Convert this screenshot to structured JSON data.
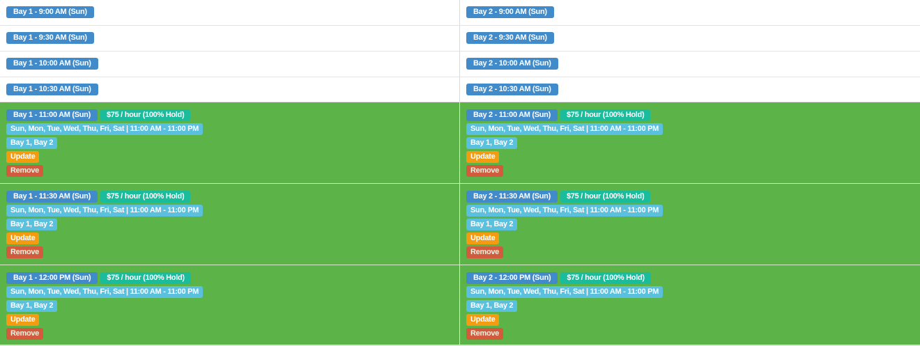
{
  "slots": [
    {
      "booked": false,
      "cells": [
        {
          "time": "Bay 1 - 9:00 AM (Sun)"
        },
        {
          "time": "Bay 2 - 9:00 AM (Sun)"
        }
      ]
    },
    {
      "booked": false,
      "cells": [
        {
          "time": "Bay 1 - 9:30 AM (Sun)"
        },
        {
          "time": "Bay 2 - 9:30 AM (Sun)"
        }
      ]
    },
    {
      "booked": false,
      "cells": [
        {
          "time": "Bay 1 - 10:00 AM (Sun)"
        },
        {
          "time": "Bay 2 - 10:00 AM (Sun)"
        }
      ]
    },
    {
      "booked": false,
      "cells": [
        {
          "time": "Bay 1 - 10:30 AM (Sun)"
        },
        {
          "time": "Bay 2 - 10:30 AM (Sun)"
        }
      ]
    },
    {
      "booked": true,
      "cells": [
        {
          "time": "Bay 1 - 11:00 AM (Sun)",
          "price": "$75 / hour (100% Hold)",
          "schedule": "Sun, Mon, Tue, Wed, Thu, Fri, Sat | 11:00 AM - 11:00 PM",
          "bays": "Bay 1, Bay 2",
          "update_label": "Update",
          "remove_label": "Remove"
        },
        {
          "time": "Bay 2 - 11:00 AM (Sun)",
          "price": "$75 / hour (100% Hold)",
          "schedule": "Sun, Mon, Tue, Wed, Thu, Fri, Sat | 11:00 AM - 11:00 PM",
          "bays": "Bay 1, Bay 2",
          "update_label": "Update",
          "remove_label": "Remove"
        }
      ]
    },
    {
      "booked": true,
      "cells": [
        {
          "time": "Bay 1 - 11:30 AM (Sun)",
          "price": "$75 / hour (100% Hold)",
          "schedule": "Sun, Mon, Tue, Wed, Thu, Fri, Sat | 11:00 AM - 11:00 PM",
          "bays": "Bay 1, Bay 2",
          "update_label": "Update",
          "remove_label": "Remove"
        },
        {
          "time": "Bay 2 - 11:30 AM (Sun)",
          "price": "$75 / hour (100% Hold)",
          "schedule": "Sun, Mon, Tue, Wed, Thu, Fri, Sat | 11:00 AM - 11:00 PM",
          "bays": "Bay 1, Bay 2",
          "update_label": "Update",
          "remove_label": "Remove"
        }
      ]
    },
    {
      "booked": true,
      "cells": [
        {
          "time": "Bay 1 - 12:00 PM (Sun)",
          "price": "$75 / hour (100% Hold)",
          "schedule": "Sun, Mon, Tue, Wed, Thu, Fri, Sat | 11:00 AM - 11:00 PM",
          "bays": "Bay 1, Bay 2",
          "update_label": "Update",
          "remove_label": "Remove"
        },
        {
          "time": "Bay 2 - 12:00 PM (Sun)",
          "price": "$75 / hour (100% Hold)",
          "schedule": "Sun, Mon, Tue, Wed, Thu, Fri, Sat | 11:00 AM - 11:00 PM",
          "bays": "Bay 1, Bay 2",
          "update_label": "Update",
          "remove_label": "Remove"
        }
      ]
    }
  ],
  "colors": {
    "booked_background": "#5cb448",
    "time_label": "#428bca",
    "price_label": "#1abc9c",
    "info_label": "#5bc0de",
    "update_button": "#f39c12",
    "remove_button": "#e74c3c"
  }
}
